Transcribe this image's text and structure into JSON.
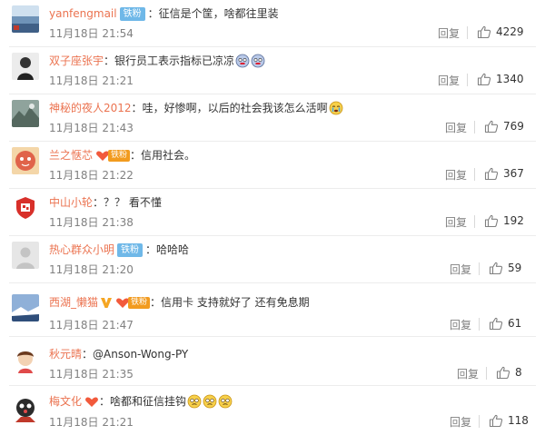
{
  "comments": [
    {
      "user": "yanfengmail",
      "badge": "铁粉",
      "text": "征信是个筐，啥都往里装",
      "time": "11月18日 21:54",
      "reply": "回复",
      "likes": "4229",
      "avatar_color": "#9bb7d4"
    },
    {
      "user": "双子座张宇",
      "text": "银行员工表示指标已凉凉",
      "time": "11月18日 21:21",
      "reply": "回复",
      "likes": "1340",
      "avatar_color": "#cfcfcf",
      "emojis": [
        "frozen-face",
        "frozen-face"
      ]
    },
    {
      "user": "神秘的夜人2012",
      "text": "哇，好惨啊，以后的社会我该怎么活啊",
      "time": "11月18日 21:43",
      "reply": "回复",
      "likes": "769",
      "avatar_color": "#7c8e88",
      "emojis": [
        "crying-face"
      ]
    },
    {
      "user": "兰之惬芯",
      "fan_badge": "铁粉",
      "text": "信用社会。",
      "time": "11月18日 21:22",
      "reply": "回复",
      "likes": "367",
      "avatar_color": "#e0634a"
    },
    {
      "user": "中山小轮",
      "text": "？？ 看不懂",
      "time": "11月18日 21:38",
      "reply": "回复",
      "likes": "192",
      "avatar_color": "#d8302a"
    },
    {
      "user": "热心群众小明",
      "badge": "铁粉",
      "text": "哈哈哈",
      "time": "11月18日 21:20",
      "reply": "回复",
      "likes": "59",
      "avatar_color": "#e6e6e6"
    },
    {
      "user": "西湖_懒猫",
      "fan_badge": "铁粉",
      "text": "信用卡 支持就好了 还有免息期",
      "time": "11月18日 21:47",
      "reply": "回复",
      "likes": "61",
      "avatar_color": "#4f6f9f"
    },
    {
      "user": "秋元晴",
      "text": "@Anson-Wong-PY",
      "time": "11月18日 21:35",
      "reply": "回复",
      "likes": "8",
      "avatar_color": "#e9c9a8"
    },
    {
      "user": "梅文化",
      "text": "啥都和征信挂钩",
      "time": "11月18日 21:21",
      "reply": "回复",
      "likes": "118",
      "avatar_color": "#444444",
      "emojis": [
        "confused-face",
        "confused-face",
        "confused-face"
      ]
    }
  ],
  "colors": {
    "username": "#eb7350",
    "badge": "#6fb8e8",
    "fan_badge": "#f29b1f",
    "meta": "#808080"
  }
}
